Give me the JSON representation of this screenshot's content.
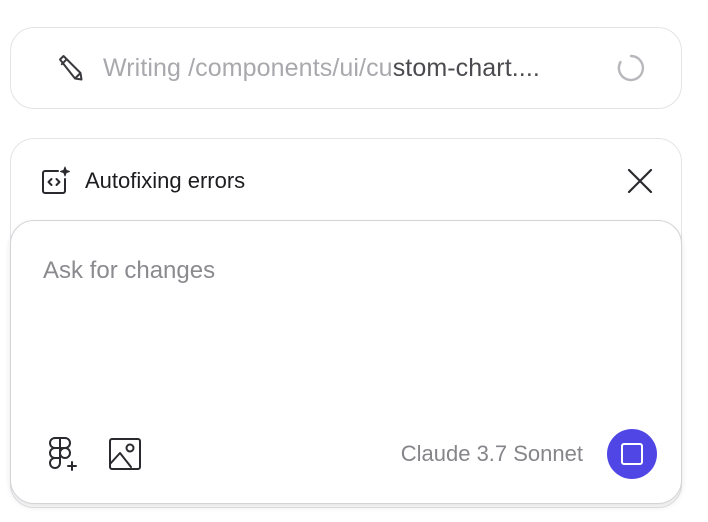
{
  "status": {
    "action_word": "Writing",
    "path_faded": "/components/ui/cu",
    "path_strong": "stom-chart....",
    "pencil_icon": "pencil-icon",
    "spinner_icon": "loading-spinner-icon"
  },
  "autofix": {
    "label": "Autofixing errors",
    "icon": "code-sparkle-icon",
    "close_icon": "close-icon"
  },
  "composer": {
    "placeholder": "Ask for changes",
    "value": "",
    "figma_icon": "figma-plus-icon",
    "image_icon": "image-icon",
    "model": "Claude 3.7 Sonnet",
    "stop_icon": "stop-icon",
    "accent": "#5046e5"
  }
}
